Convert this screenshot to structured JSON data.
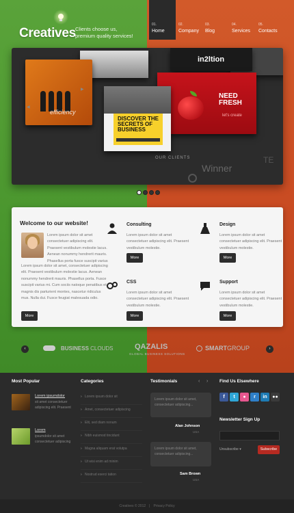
{
  "header": {
    "logo": "Creatives",
    "tagline_line1": "Clients choose us,",
    "tagline_line2": "premium quality services!",
    "nav": [
      {
        "num": "01.",
        "label": "Home"
      },
      {
        "num": "02.",
        "label": "Company"
      },
      {
        "num": "03.",
        "label": "Blog"
      },
      {
        "num": "04.",
        "label": "Services"
      },
      {
        "num": "05.",
        "label": "Contacts"
      }
    ]
  },
  "slider": {
    "card_efficiency": "efficiency",
    "book_title": "DISCOVER THE SECRETS OF BUSINESS",
    "inz": "in2ltion",
    "need_fresh": "NEED FRESH",
    "lets_create": "let's create",
    "clients_label": "OUR CLIENTS",
    "winner": "Winner",
    "te": "TE",
    "active_slide_index": 0,
    "dot_count": 4
  },
  "welcome": {
    "title": "Welcome to our website!",
    "text1": "Lorem ipsum dolor sit amet consectetuer adipiscing elit. Praesent vestibulum molestie lacus. Aenean nonummy hendrerit mauris. Phasellus porta fusce suscipit varius mi. Cum sociis natoque penatibus et dolor magnis dis parturient.",
    "text2": "Lorem ipsum dolor sit amet, consectetuer adipiscing elit. Praesent vestibulum molestie lacus. Aenean nonummy hendrerit mauris. Phasellus porta. Fusce suscipit varius mi. Cum sociis natoque penatibus et magnis dis parturient montes, nascetur ridiculus mus. Nulla dui. Fusce feugiat malesuada odio. Morbi nunc odio, gravida at, cursus nec, luctus a, lorem. Maecenas tristique orci ac sem. Duis ultricies pharetra magna. Donec accumsan malesuada orci. Donec sit amet eros.",
    "more": "More"
  },
  "services": [
    {
      "title": "Consulting",
      "text": "Lorem ipsum dolor sit amet consectetuer adipiscing elit. Praesent vestibulum molestie.",
      "more": "More"
    },
    {
      "title": "Design",
      "text": "Lorem ipsum dolor sit amet consectetuer adipiscing elit. Praesent vestibulum molestie.",
      "more": "More"
    },
    {
      "title": "CSS",
      "text": "Lorem ipsum dolor sit amet consectetuer adipiscing elit. Praesent vestibulum molestie.",
      "more": "More"
    },
    {
      "title": "Support",
      "text": "Lorem ipsum dolor sit amet consectetuer adipiscing elit. Praesent vestibulum molestie.",
      "more": "More"
    }
  ],
  "partners": {
    "business": "BUSINESS",
    "clouds": "CLOUDS",
    "qazalis": "QAZALIS",
    "qazalis_sub": "GLOBAL BUSINESS SOLUTIONS",
    "smart": "SMART",
    "group": "GROUP"
  },
  "footer": {
    "most_popular": {
      "title": "Most Popular",
      "items": [
        {
          "link": "Lorem ipsumdolor",
          "text": "sit amet consectetuer adipiscing elit. Praesent vestibulum"
        },
        {
          "link": "Lorem",
          "text": "ipsumdolor sit amet consectetuer adipiscing elit. Praesent vestibulum"
        }
      ]
    },
    "categories": {
      "title": "Categories",
      "items": [
        "Lorem ipsum dolor sit",
        "Amet, consectetuer adipiscing",
        "Elit, sed diam nonum",
        "Nibh euismod tincidunt",
        "Magna aliquam erat volutpa",
        "Ut wisi enim ad minim",
        "Nostrud exerci tation"
      ]
    },
    "testimonials": {
      "title": "Testimonials",
      "prev": "‹",
      "next": "›",
      "items": [
        {
          "quote": "Lorem ipsum dolor sit amet, consectetuer adipiscing...",
          "name": "Alan Johnson",
          "loc": "USA"
        },
        {
          "quote": "Lorem ipsum dolor sit amet, consectetuer adipiscing...",
          "name": "Sam Brown",
          "loc": "USA"
        }
      ]
    },
    "find_us": {
      "title": "Find Us Elsewhere",
      "icons": [
        {
          "name": "facebook",
          "glyph": "f",
          "color": "#3b5998"
        },
        {
          "name": "twitter",
          "glyph": "t",
          "color": "#2fa6d6"
        },
        {
          "name": "dribbble",
          "glyph": "●",
          "color": "#e8578f"
        },
        {
          "name": "rss",
          "glyph": "r",
          "color": "#2f7fc8"
        },
        {
          "name": "linkedin",
          "glyph": "in",
          "color": "#1e7bb4"
        },
        {
          "name": "flickr",
          "glyph": "●●",
          "color": "#3a3a3a"
        }
      ]
    },
    "newsletter": {
      "title": "Newsletter Sign Up",
      "unsubscribe": "Unsubscribe",
      "subscribe": "Subscribe"
    },
    "copyright": "Creatives © 2012",
    "privacy": "Privacy Policy"
  }
}
